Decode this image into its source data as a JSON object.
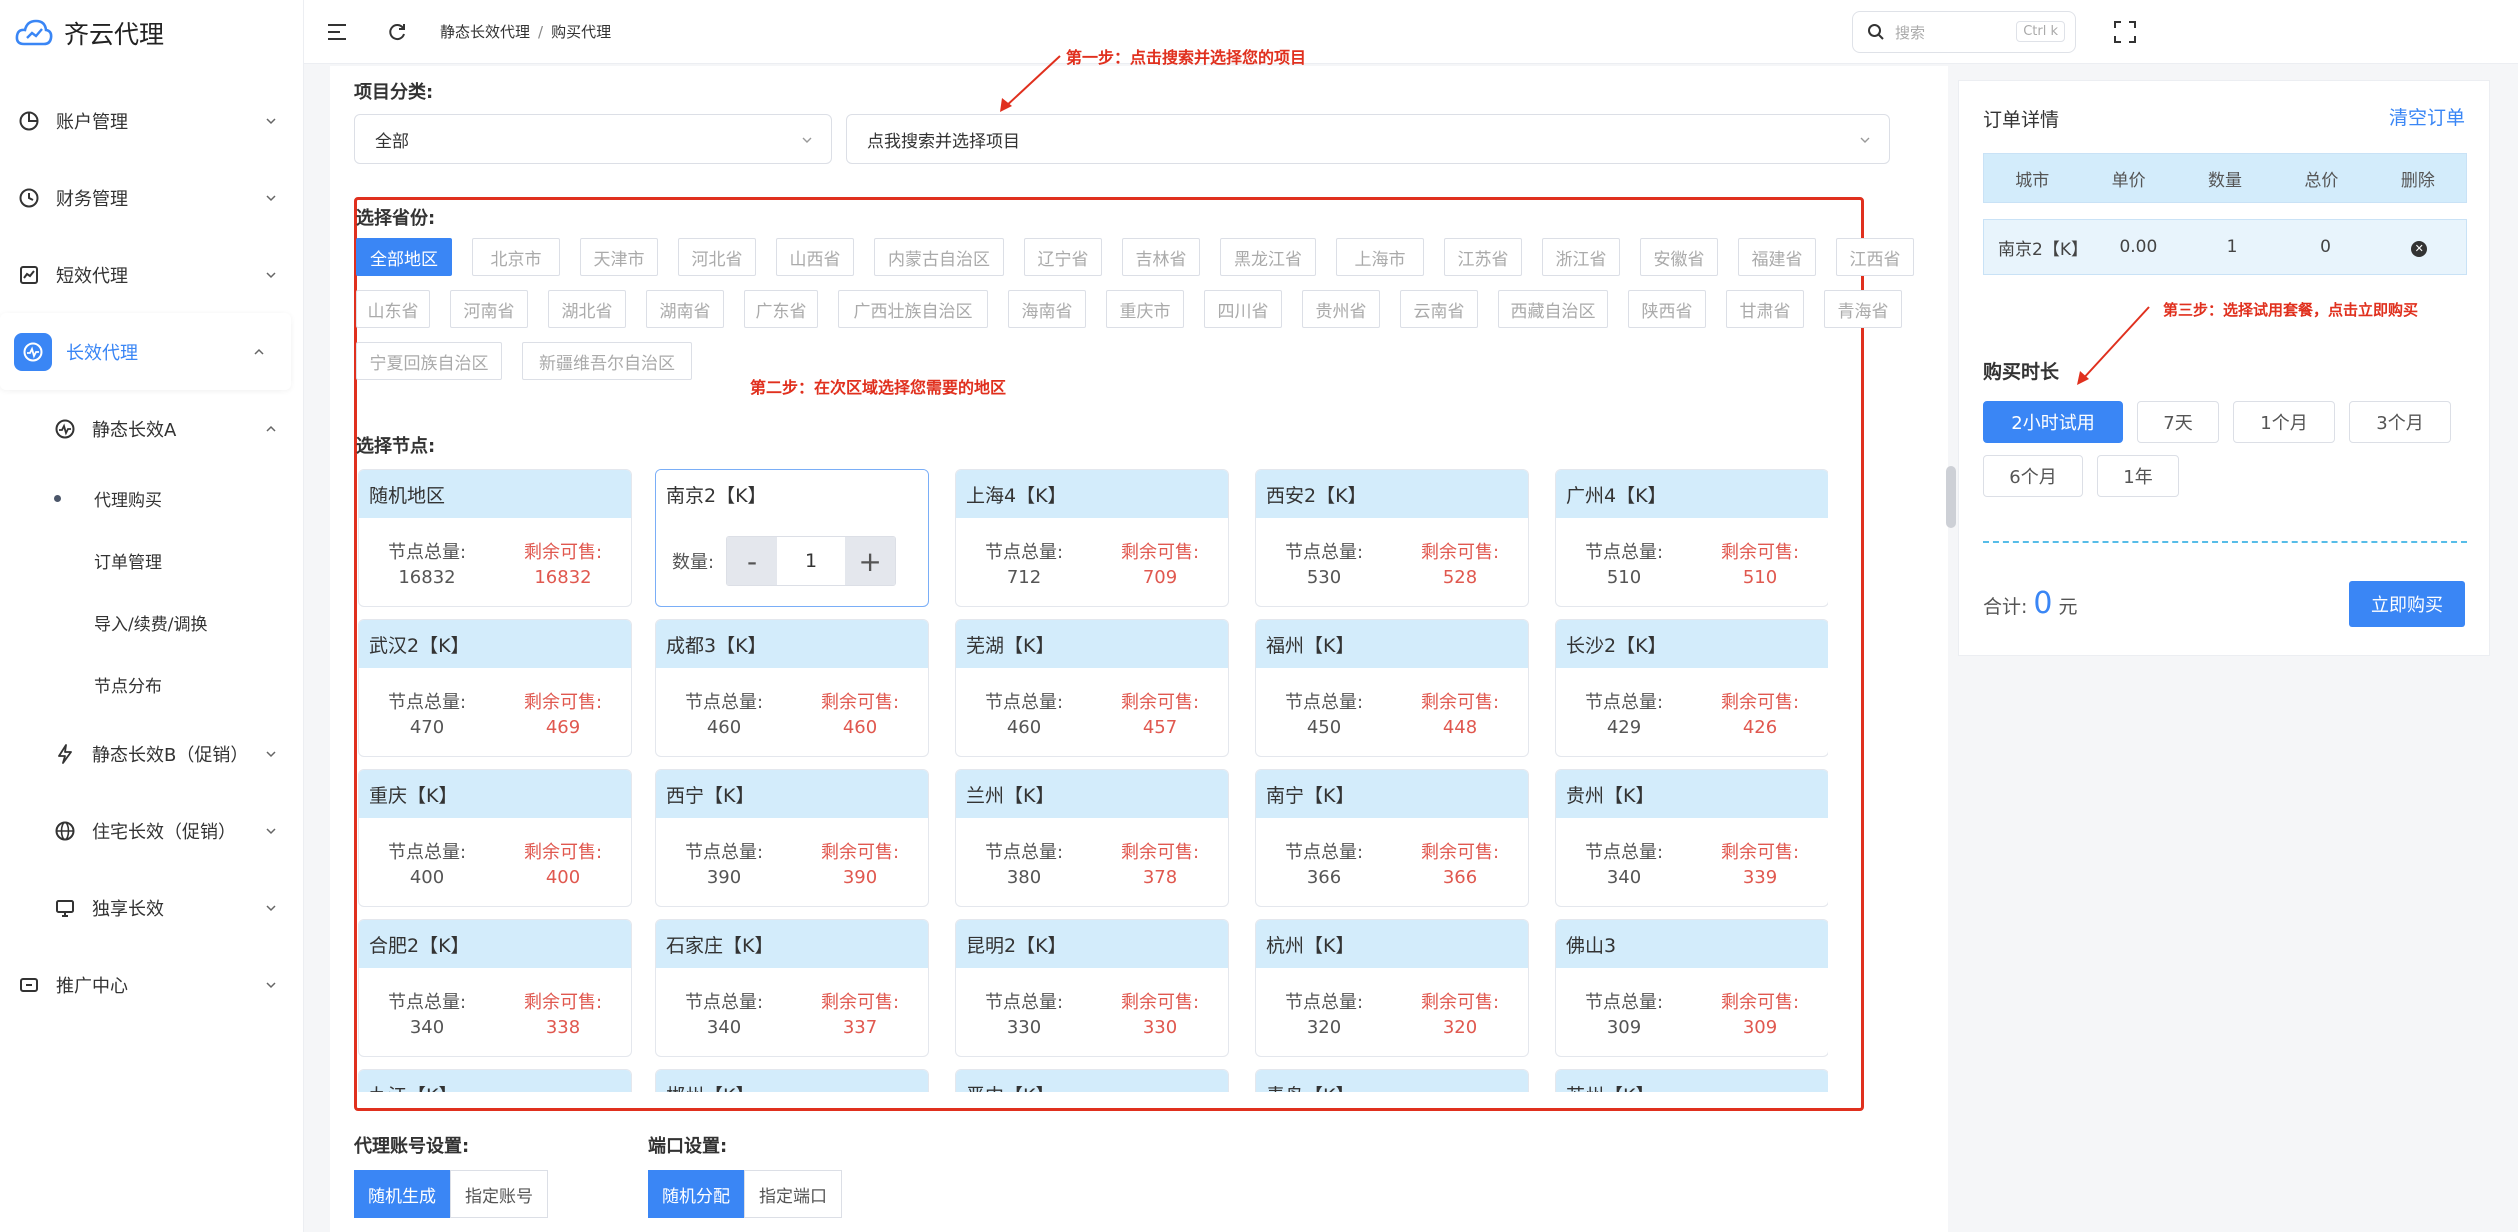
{
  "brand": {
    "name": "齐云代理"
  },
  "sidebar": {
    "items": [
      {
        "label": "账户管理"
      },
      {
        "label": "财务管理"
      },
      {
        "label": "短效代理"
      },
      {
        "label": "长效代理"
      },
      {
        "label": "静态长效A"
      },
      {
        "label": "代理购买"
      },
      {
        "label": "订单管理"
      },
      {
        "label": "导入/续费/调换"
      },
      {
        "label": "节点分布"
      },
      {
        "label": "静态长效B（促销）"
      },
      {
        "label": "住宅长效（促销）"
      },
      {
        "label": "独享长效"
      },
      {
        "label": "推广中心"
      }
    ]
  },
  "topbar": {
    "breadcrumb": [
      "静态长效代理",
      "购买代理"
    ],
    "breadcrumb_sep": "/",
    "search_placeholder": "搜索",
    "search_kbd": "Ctrl k"
  },
  "filters": {
    "category_label": "项目分类:",
    "category_value": "全部",
    "project_value": "点我搜索并选择项目"
  },
  "annotations": {
    "step1": "第一步：点击搜索并选择您的项目",
    "step2": "第二步：在次区域选择您需要的地区",
    "step3": "第三步：选择试用套餐，点击立即购买"
  },
  "provinces": {
    "label": "选择省份:",
    "items": [
      "全部地区",
      "北京市",
      "天津市",
      "河北省",
      "山西省",
      "内蒙古自治区",
      "辽宁省",
      "吉林省",
      "黑龙江省",
      "上海市",
      "江苏省",
      "浙江省",
      "安徽省",
      "福建省",
      "江西省",
      "山东省",
      "河南省",
      "湖北省",
      "湖南省",
      "广东省",
      "广西壮族自治区",
      "海南省",
      "重庆市",
      "四川省",
      "贵州省",
      "云南省",
      "西藏自治区",
      "陕西省",
      "甘肃省",
      "青海省",
      "宁夏回族自治区",
      "新疆维吾尔自治区"
    ],
    "selected": "全部地区"
  },
  "nodes": {
    "label": "选择节点:",
    "total_label": "节点总量:",
    "remain_label": "剩余可售:",
    "qty_label": "数量:",
    "qty_value": "1",
    "qty_minus": "-",
    "qty_plus": "+",
    "items": [
      {
        "name": "随机地区",
        "total": "16832",
        "remain": "16832"
      },
      {
        "name": "南京2【K】",
        "selected": true
      },
      {
        "name": "上海4【K】",
        "total": "712",
        "remain": "709"
      },
      {
        "name": "西安2【K】",
        "total": "530",
        "remain": "528"
      },
      {
        "name": "广州4【K】",
        "total": "510",
        "remain": "510"
      },
      {
        "name": "武汉2【K】",
        "total": "470",
        "remain": "469"
      },
      {
        "name": "成都3【K】",
        "total": "460",
        "remain": "460"
      },
      {
        "name": "芜湖【K】",
        "total": "460",
        "remain": "457"
      },
      {
        "name": "福州【K】",
        "total": "450",
        "remain": "448"
      },
      {
        "name": "长沙2【K】",
        "total": "429",
        "remain": "426"
      },
      {
        "name": "重庆【K】",
        "total": "400",
        "remain": "400"
      },
      {
        "name": "西宁【K】",
        "total": "390",
        "remain": "390"
      },
      {
        "name": "兰州【K】",
        "total": "380",
        "remain": "378"
      },
      {
        "name": "南宁【K】",
        "total": "366",
        "remain": "366"
      },
      {
        "name": "贵州【K】",
        "total": "340",
        "remain": "339"
      },
      {
        "name": "合肥2【K】",
        "total": "340",
        "remain": "338"
      },
      {
        "name": "石家庄【K】",
        "total": "340",
        "remain": "337"
      },
      {
        "name": "昆明2【K】",
        "total": "330",
        "remain": "330"
      },
      {
        "name": "杭州【K】",
        "total": "320",
        "remain": "320"
      },
      {
        "name": "佛山3",
        "total": "309",
        "remain": "309"
      },
      {
        "name": "九江【K】",
        "total": "",
        "remain": ""
      },
      {
        "name": "郴州【K】",
        "total": "",
        "remain": ""
      },
      {
        "name": "晋中【K】",
        "total": "",
        "remain": ""
      },
      {
        "name": "青岛【K】",
        "total": "",
        "remain": ""
      },
      {
        "name": "苏州【K】",
        "total": "",
        "remain": ""
      }
    ]
  },
  "account_settings": {
    "label": "代理账号设置:",
    "options": [
      "随机生成",
      "指定账号"
    ]
  },
  "port_settings": {
    "label": "端口设置:",
    "options": [
      "随机分配",
      "指定端口"
    ]
  },
  "order": {
    "title": "订单详情",
    "clear": "清空订单",
    "columns": [
      "城市",
      "单价",
      "数量",
      "总价",
      "删除"
    ],
    "rows": [
      {
        "city": "南京2【K】",
        "price": "0.00",
        "qty": "1",
        "total": "0"
      }
    ],
    "duration_title": "购买时长",
    "durations": [
      "2小时试用",
      "7天",
      "1个月",
      "3个月",
      "6个月",
      "1年"
    ],
    "total_label": "合计:",
    "total_value": "0",
    "total_unit": "元",
    "buy": "立即购买"
  },
  "colors": {
    "accent": "#3a86f5",
    "annotation": "#e0301e",
    "card_header": "#d3ecfb",
    "remain": "#e0584f"
  }
}
